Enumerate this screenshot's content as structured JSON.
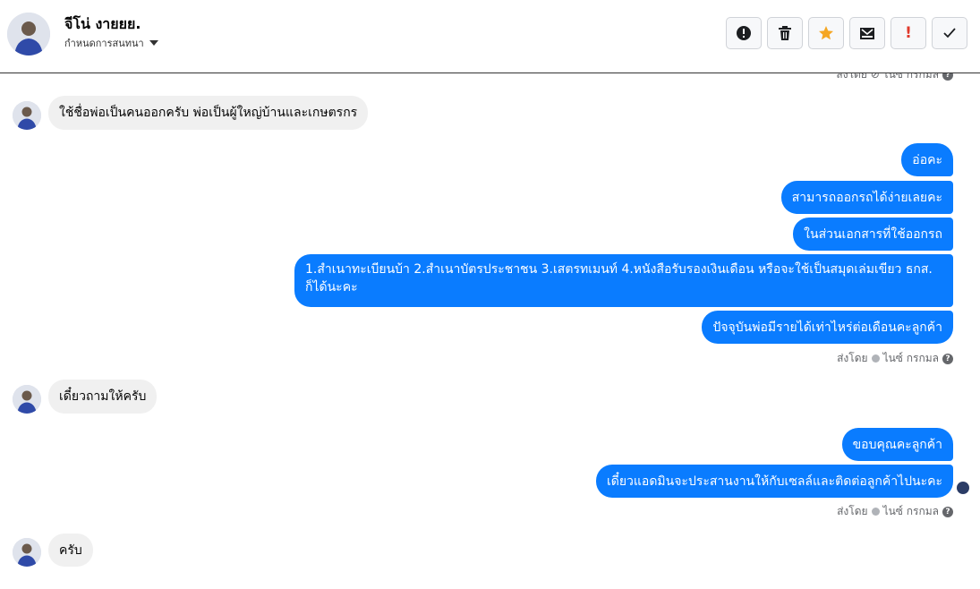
{
  "header": {
    "name": "จีโน่ งายยย.",
    "subtitle": "กำหนดการสนทนา"
  },
  "toolbar": {
    "buttons": [
      "info-icon",
      "trash-icon",
      "star-icon",
      "envelope-icon",
      "exclamation-icon",
      "check-icon"
    ],
    "exclaim_text": "!",
    "accent": "#f5a623",
    "alert": "#e0392b"
  },
  "colors": {
    "outgoing": "#0a7cff",
    "incoming": "#f0f0f0"
  },
  "meta": {
    "top": "ส่งโดย ⊘ ไนซ์ กรกมล",
    "sent_by": "ส่งโดย",
    "sender": "ไนซ์ กรกมล"
  },
  "messages": {
    "m1": "ใช้ชื่อพ่อเป็นคนออกครับ พ่อเป็นผู้ใหญ่บ้านและเกษตรกร",
    "m2": "อ่อคะ",
    "m3": "สามารถออกรถได้ง่ายเลยคะ",
    "m4": "ในส่วนเอกสารที่ใช้ออกรถ",
    "m5": "1.สำเนาทะเบียนบ้า 2.สำเนาบัตรประชาชน 3.เสตรทเมนท์ 4.หนังสือรับรองเงินเดือน หรือจะใช้เป็นสมุดเล่มเขียว ธกส. ก็ได้นะคะ",
    "m6": "ปัจจุบันพ่อมีรายได้เท่าไหร่ต่อเดือนคะลูกค้า",
    "m7": "เดี๋ยวถามให้ครับ",
    "m8": "ขอบคุณคะลูกค้า",
    "m9": "เดี๋ยวแอดมินจะประสานงานให้กับเซลล์และติดต่อลูกค้าไปนะคะ",
    "m10": "ครับ"
  }
}
